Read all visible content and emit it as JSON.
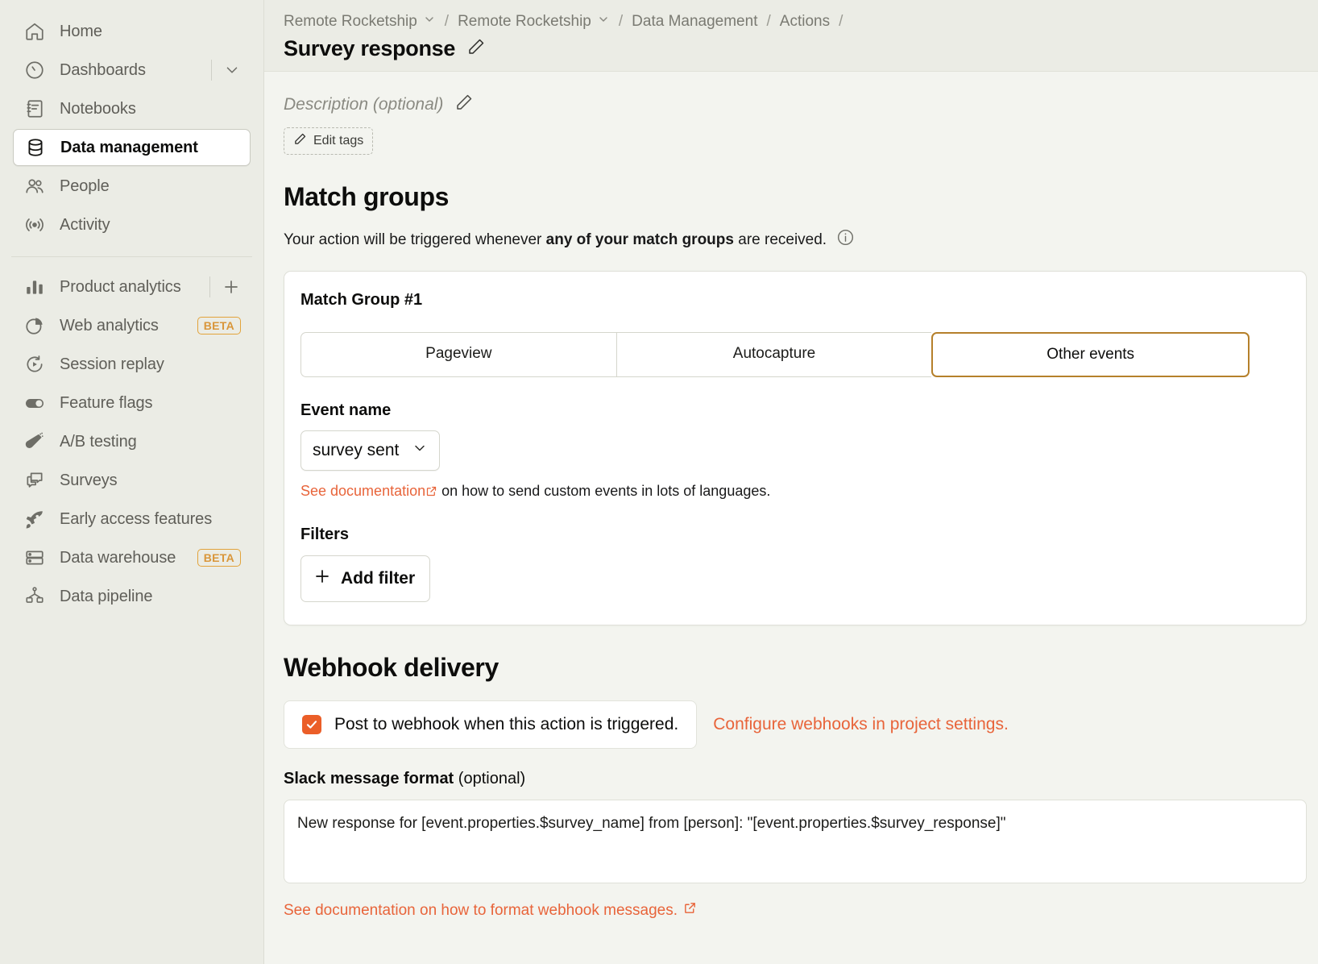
{
  "sidebar": {
    "primary_items": [
      {
        "label": "Home",
        "icon": "home-icon",
        "active": false
      },
      {
        "label": "Dashboards",
        "icon": "dashboards-icon",
        "active": false,
        "trailing": "chevron-down-icon"
      },
      {
        "label": "Notebooks",
        "icon": "notebooks-icon",
        "active": false
      },
      {
        "label": "Data management",
        "icon": "database-icon",
        "active": true
      },
      {
        "label": "People",
        "icon": "people-icon",
        "active": false
      },
      {
        "label": "Activity",
        "icon": "activity-icon",
        "active": false
      }
    ],
    "secondary_items": [
      {
        "label": "Product analytics",
        "icon": "bar-chart-icon",
        "trailing": "plus-icon"
      },
      {
        "label": "Web analytics",
        "icon": "pie-chart-icon",
        "badge": "BETA"
      },
      {
        "label": "Session replay",
        "icon": "replay-icon"
      },
      {
        "label": "Feature flags",
        "icon": "toggle-icon"
      },
      {
        "label": "A/B testing",
        "icon": "flask-icon"
      },
      {
        "label": "Surveys",
        "icon": "chat-icon"
      },
      {
        "label": "Early access features",
        "icon": "rocket-icon"
      },
      {
        "label": "Data warehouse",
        "icon": "server-icon",
        "badge": "BETA"
      },
      {
        "label": "Data pipeline",
        "icon": "pipeline-icon"
      }
    ]
  },
  "header": {
    "breadcrumb": [
      {
        "label": "Remote Rocketship",
        "has_chevron": true
      },
      {
        "label": "Remote Rocketship",
        "has_chevron": true
      },
      {
        "label": "Data Management",
        "has_chevron": false
      },
      {
        "label": "Actions",
        "has_chevron": false
      }
    ],
    "separator": "/",
    "title": "Survey response",
    "edit_title_icon": "pencil-icon"
  },
  "description": {
    "placeholder": "Description (optional)",
    "edit_icon": "pencil-icon",
    "edit_tags_label": "Edit tags"
  },
  "match_groups": {
    "heading": "Match groups",
    "subtitle_prefix": "Your action will be triggered whenever ",
    "subtitle_bold": "any of your match groups",
    "subtitle_suffix": " are received.",
    "info_icon": "info-icon",
    "group": {
      "title": "Match Group #1",
      "tabs": [
        {
          "label": "Pageview",
          "selected": false
        },
        {
          "label": "Autocapture",
          "selected": false
        },
        {
          "label": "Other events",
          "selected": true
        }
      ],
      "event_name_label": "Event name",
      "event_name_value": "survey sent",
      "event_name_chevron": "chevron-down-icon",
      "hint_link": "See documentation",
      "hint_text": " on how to send custom events in lots of languages.",
      "filters_label": "Filters",
      "add_filter_label": "Add filter"
    }
  },
  "webhook": {
    "heading": "Webhook delivery",
    "checkbox_label": "Post to webhook when this action is triggered.",
    "checkbox_checked": true,
    "configure_link": "Configure webhooks in project settings.",
    "slack_label_bold": "Slack message format",
    "slack_label_optional": " (optional)",
    "message_value": "New response for [event.properties.$survey_name] from [person]: \"[event.properties.$survey_response]\"",
    "footer_link": "See documentation on how to format webhook messages."
  },
  "colors": {
    "accent_orange": "#EB5E28",
    "link_orange": "#E8643A",
    "selected_tab_border": "#B5802B",
    "beta_badge": "#D9963A",
    "sidebar_bg": "#EBECE5",
    "page_bg": "#F3F4EF"
  }
}
